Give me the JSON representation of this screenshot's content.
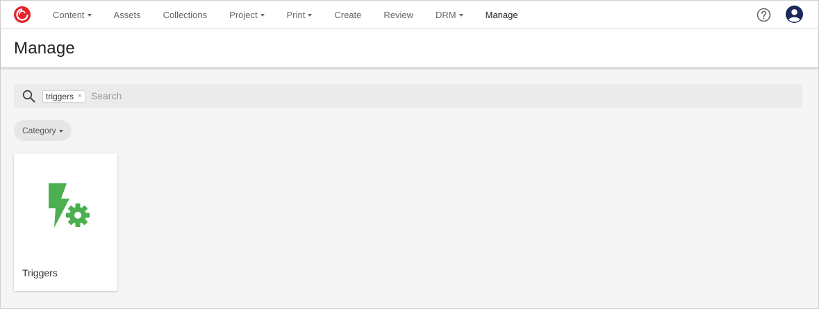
{
  "app": {
    "logo_icon": "sitecore-logo-icon",
    "brand_color": "#e3262c"
  },
  "nav": {
    "items": [
      {
        "label": "Content",
        "has_caret": true
      },
      {
        "label": "Assets",
        "has_caret": false
      },
      {
        "label": "Collections",
        "has_caret": false
      },
      {
        "label": "Project",
        "has_caret": true
      },
      {
        "label": "Print",
        "has_caret": true
      },
      {
        "label": "Create",
        "has_caret": false
      },
      {
        "label": "Review",
        "has_caret": false
      },
      {
        "label": "DRM",
        "has_caret": true
      },
      {
        "label": "Manage",
        "has_caret": false,
        "active": true
      }
    ],
    "help_icon": "help-circle-icon",
    "avatar_icon": "user-avatar-icon"
  },
  "header": {
    "title": "Manage"
  },
  "search": {
    "icon": "search-icon",
    "chip_label": "triggers",
    "chip_remove": "×",
    "placeholder": "Search",
    "value": ""
  },
  "filters": {
    "category_label": "Category"
  },
  "cards": [
    {
      "label": "Triggers",
      "icon": "lightning-gear-icon",
      "icon_color": "#4caf50"
    }
  ]
}
